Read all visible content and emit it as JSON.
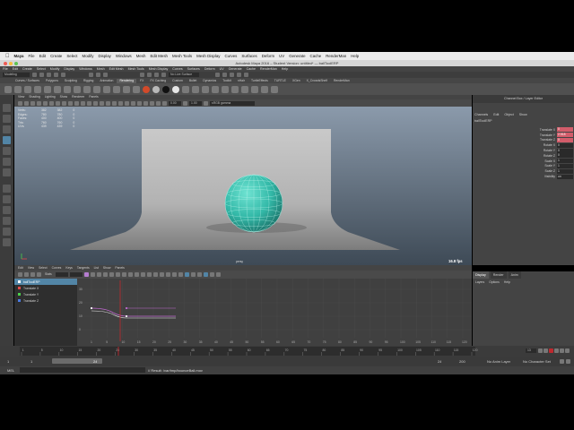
{
  "mac_menu": {
    "app": "Maya",
    "items": [
      "File",
      "Edit",
      "Create",
      "Select",
      "Modify",
      "Display",
      "Windows",
      "Mesh",
      "Edit Mesh",
      "Mesh Tools",
      "Mesh Display",
      "Curves",
      "Surfaces",
      "Deform",
      "UV",
      "Generate",
      "Cache",
      "RenderMan",
      "Help"
    ]
  },
  "window": {
    "title": "Autodesk Maya 2016 – Student Version: untitled* — ballToolERP"
  },
  "maya_menu": {
    "items": [
      "File",
      "Edit",
      "Create",
      "Select",
      "Modify",
      "Display",
      "Windows",
      "Mesh",
      "Edit Mesh",
      "Mesh Tools",
      "Mesh Display",
      "Curves",
      "Surfaces",
      "Deform",
      "UV",
      "Generate",
      "Cache",
      "RenderMan",
      "Help"
    ]
  },
  "status_line": {
    "mode": "Modeling",
    "live_surface": "No Live Surface"
  },
  "shelf": {
    "tabs": [
      "Curves / Surfaces",
      "Polygons",
      "Sculpting",
      "Rigging",
      "Animation",
      "Rendering",
      "FX",
      "FX Caching",
      "Custom",
      "Bullet",
      "Dynamics",
      "Toolkit",
      "nHair",
      "TurtleEffects",
      "TURTLE",
      "XGen",
      "X_CrowdsShelf",
      "RenderMan"
    ],
    "active_tab": "Rendering"
  },
  "viewport": {
    "menu": [
      "View",
      "Shading",
      "Lighting",
      "Show",
      "Renderer",
      "Panels"
    ],
    "gamma_label": "sRGB gamma",
    "field_a": "0.00",
    "field_b": "1.00",
    "hud": [
      {
        "label": "Verts:",
        "v1": "382",
        "v2": "382",
        "v3": "0"
      },
      {
        "label": "Edges:",
        "v1": "780",
        "v2": "780",
        "v3": "0"
      },
      {
        "label": "Faces:",
        "v1": "400",
        "v2": "400",
        "v3": "0"
      },
      {
        "label": "Tris:",
        "v1": "760",
        "v2": "760",
        "v3": "0"
      },
      {
        "label": "UVs:",
        "v1": "439",
        "v2": "439",
        "v3": "0"
      }
    ],
    "camera_label": "persp",
    "fps": "16.8 fps"
  },
  "channel_box": {
    "header": "Channel Box / Layer Editor",
    "menu": [
      "Channels",
      "Edit",
      "Object",
      "Show"
    ],
    "object_name": "ballToolERP",
    "attributes": [
      {
        "label": "Translate X",
        "value": "0",
        "keyed": true
      },
      {
        "label": "Translate Y",
        "value": "2.518",
        "keyed": true
      },
      {
        "label": "Translate Z",
        "value": "0",
        "keyed": true
      },
      {
        "label": "Rotate X",
        "value": "0",
        "keyed": false
      },
      {
        "label": "Rotate Y",
        "value": "0",
        "keyed": false
      },
      {
        "label": "Rotate Z",
        "value": "0",
        "keyed": false
      },
      {
        "label": "Scale X",
        "value": "1",
        "keyed": false
      },
      {
        "label": "Scale Y",
        "value": "1",
        "keyed": false
      },
      {
        "label": "Scale Z",
        "value": "1",
        "keyed": false
      },
      {
        "label": "Visibility",
        "value": "on",
        "keyed": false
      }
    ]
  },
  "graph_editor": {
    "menu": [
      "Edit",
      "View",
      "Select",
      "Curves",
      "Keys",
      "Tangents",
      "List",
      "Show",
      "Panels"
    ],
    "stats_label": "Stats",
    "outliner": [
      {
        "label": "ballToolERP",
        "selected": true,
        "color": "#ffffff"
      },
      {
        "label": "Translate X",
        "selected": false,
        "color": "#e04a4a"
      },
      {
        "label": "Translate Y",
        "selected": false,
        "color": "#4ad04a"
      },
      {
        "label": "Translate Z",
        "selected": false,
        "color": "#4a7ae0"
      }
    ],
    "y_ticks": [
      "30",
      "20",
      "10",
      "0"
    ],
    "x_ticks": [
      "1",
      "5",
      "10",
      "15",
      "20",
      "25",
      "30",
      "35",
      "40",
      "45",
      "50",
      "55",
      "60",
      "65",
      "70",
      "75",
      "80",
      "85",
      "90",
      "95",
      "100",
      "105",
      "110",
      "115",
      "120"
    ]
  },
  "layer_editor": {
    "tabs": [
      "Display",
      "Render",
      "Anim"
    ],
    "active_tab": "Display",
    "sub_menu": [
      "Layers",
      "Options",
      "Help"
    ]
  },
  "time_slider": {
    "ticks": [
      "1",
      "5",
      "10",
      "15",
      "20",
      "25",
      "30",
      "35",
      "40",
      "45",
      "50",
      "55",
      "60",
      "65",
      "70",
      "75",
      "80",
      "85",
      "90",
      "95",
      "100",
      "105",
      "110",
      "115",
      "120"
    ],
    "current_frame": "13"
  },
  "range_slider": {
    "start": "1",
    "inner_start": "1",
    "range_label": "24",
    "inner_end": "24",
    "end": "200",
    "anim_layer": "No Anim Layer",
    "character_set": "No Character Set"
  },
  "command_line": {
    "lang": "MEL",
    "result": "// Result: /var/tmp/bounceBall.mov"
  },
  "colors": {
    "sphere": "#3fc3b1",
    "key_red": "#d25c6a",
    "playhead": "#c0282e"
  }
}
